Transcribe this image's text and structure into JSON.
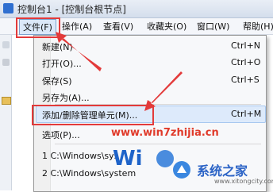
{
  "window": {
    "title": "控制台1 - [控制台根节点]"
  },
  "menubar": {
    "items": [
      {
        "label": "文件(F)"
      },
      {
        "label": "操作(A)"
      },
      {
        "label": "查看(V)"
      },
      {
        "label": "收藏夹(O)"
      },
      {
        "label": "窗口(W)"
      },
      {
        "label": "帮助(H)"
      }
    ]
  },
  "file_menu": {
    "items": [
      {
        "label": "新建(N)",
        "shortcut": "Ctrl+N"
      },
      {
        "label": "打开(O)...",
        "shortcut": "Ctrl+O"
      },
      {
        "label": "保存(S)",
        "shortcut": "Ctrl+S"
      },
      {
        "label": "另存为(A)...",
        "shortcut": ""
      },
      {
        "label": "添加/删除管理单元(M)...",
        "shortcut": "Ctrl+M"
      },
      {
        "label": "选项(P)...",
        "shortcut": ""
      },
      {
        "label": "1 C:\\Windows\\sys",
        "shortcut": ""
      },
      {
        "label": "2 C:\\Windows\\system",
        "shortcut": ""
      }
    ]
  },
  "overlay": {
    "watermark": "www.win7zhijia.cn",
    "logo_text": "系统之家",
    "site": "www.xitongcity.com"
  },
  "colors": {
    "accent_red": "#e33a3a",
    "menu_highlight": "#ddeafb",
    "brand_blue": "#2b63c6"
  }
}
